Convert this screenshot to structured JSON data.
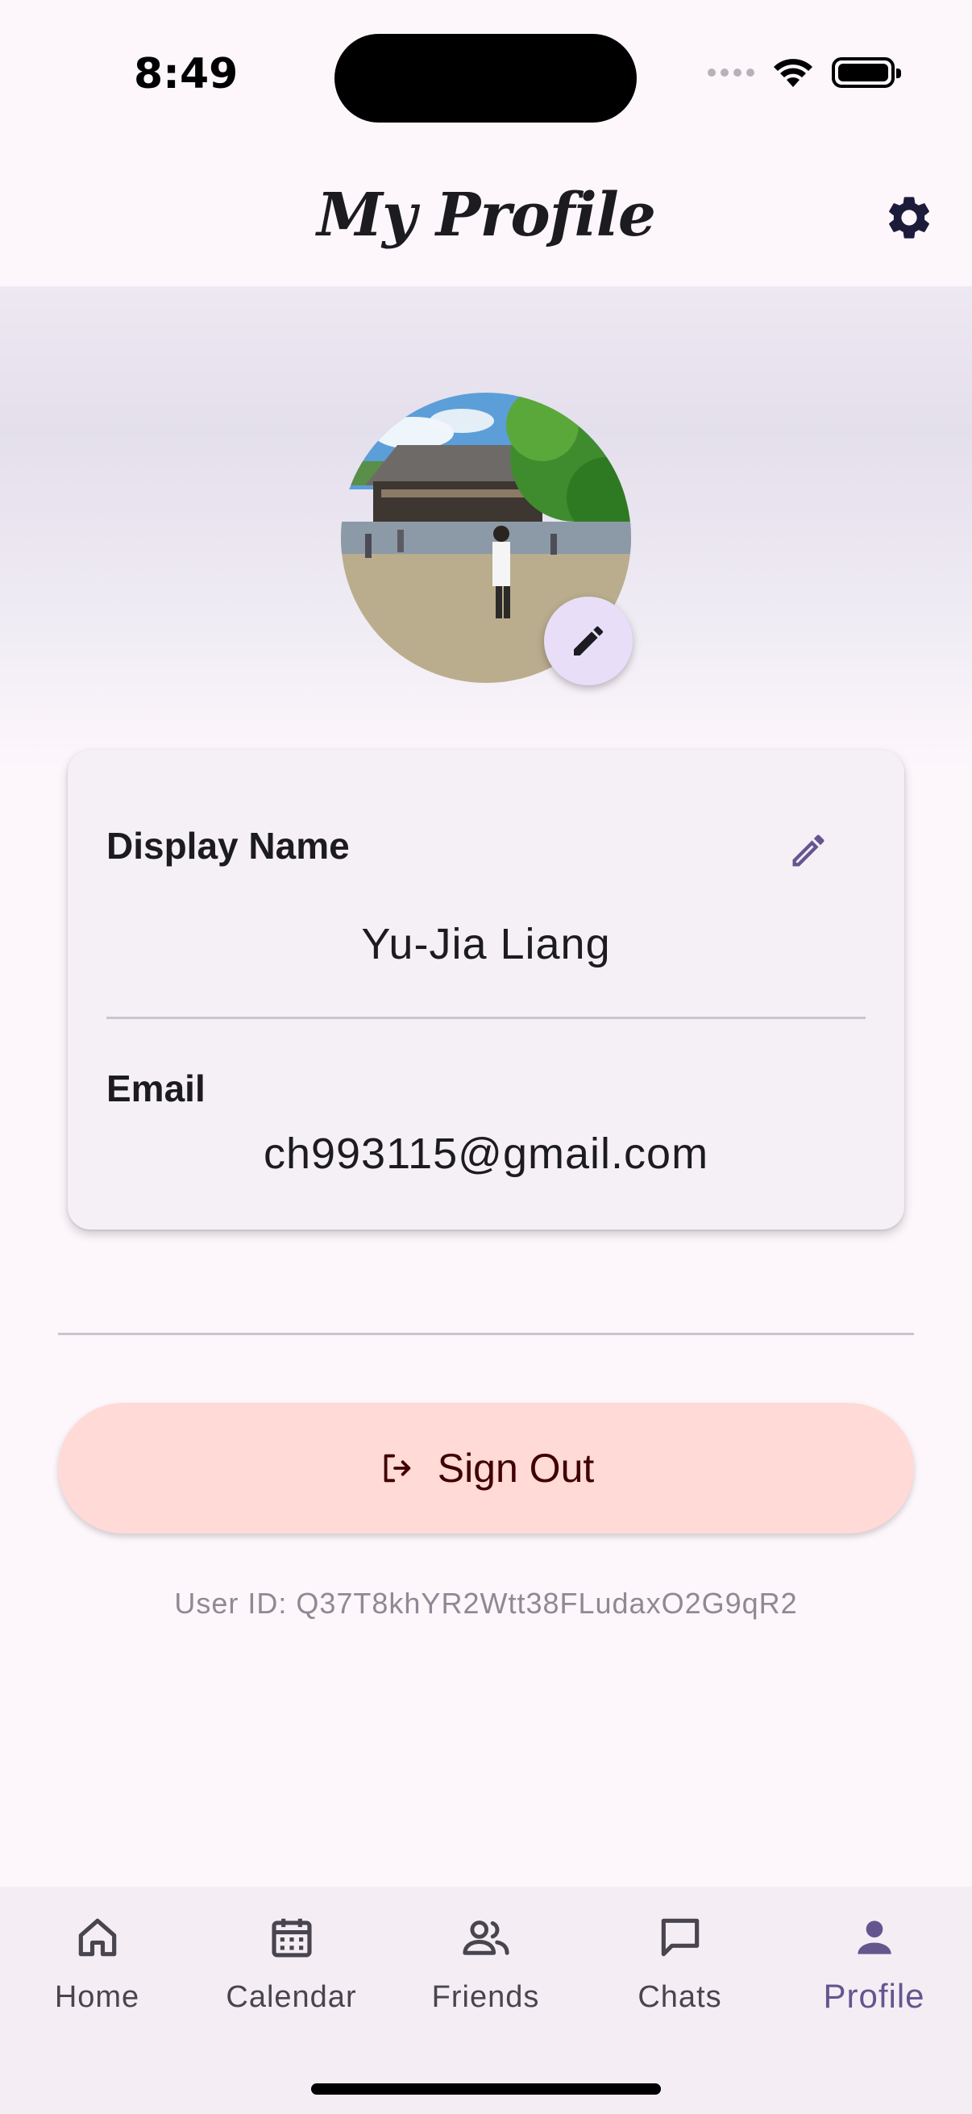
{
  "status_bar": {
    "time": "8:49"
  },
  "app_bar": {
    "title": "My Profile",
    "settings_icon": "gear-icon"
  },
  "profile": {
    "display_name_label": "Display Name",
    "display_name": "Yu-Jia Liang",
    "email_label": "Email",
    "email": "ch993115@gmail.com"
  },
  "actions": {
    "sign_out_label": "Sign Out"
  },
  "footer": {
    "user_id": "User ID: Q37T8khYR2Wtt38FLudaxO2G9qR2"
  },
  "bottom_nav": {
    "items": [
      {
        "label": "Home",
        "icon": "home-icon"
      },
      {
        "label": "Calendar",
        "icon": "calendar-icon"
      },
      {
        "label": "Friends",
        "icon": "friends-icon"
      },
      {
        "label": "Chats",
        "icon": "chat-icon"
      },
      {
        "label": "Profile",
        "icon": "person-icon",
        "active": true
      }
    ]
  },
  "colors": {
    "background": "#fdf7fc",
    "accent": "#65558f",
    "sign_out_bg": "#ffdad6",
    "card_bg": "#f5f0f6"
  }
}
